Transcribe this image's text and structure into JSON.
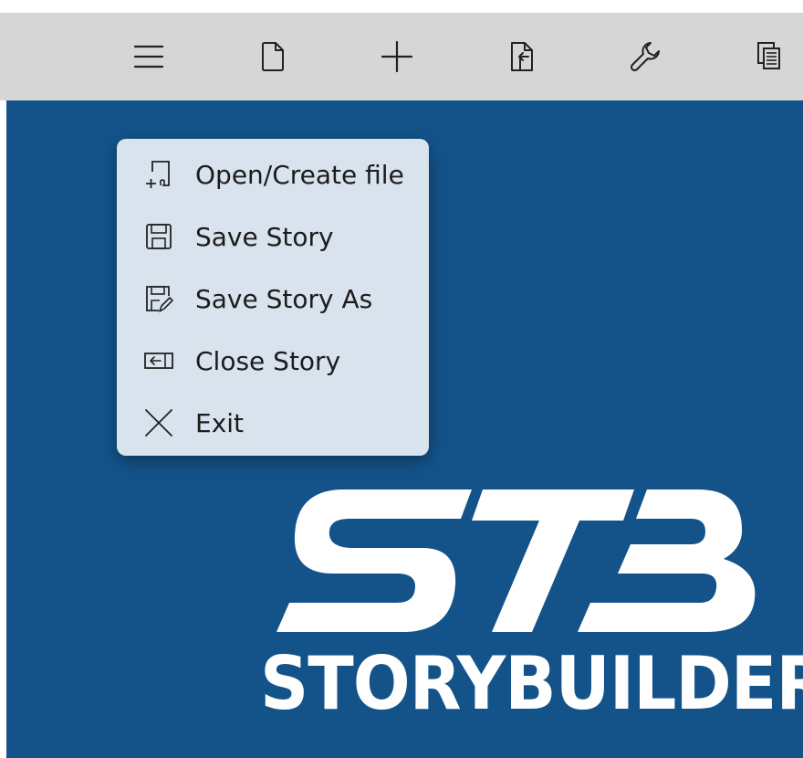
{
  "toolbar": {
    "buttons": [
      {
        "name": "menu",
        "icon": "hamburger-icon"
      },
      {
        "name": "new-file",
        "icon": "document-icon"
      },
      {
        "name": "add",
        "icon": "plus-icon"
      },
      {
        "name": "import",
        "icon": "import-icon"
      },
      {
        "name": "tools",
        "icon": "wrench-icon"
      },
      {
        "name": "copy",
        "icon": "copy-icon"
      }
    ]
  },
  "menu": {
    "items": [
      {
        "label": "Open/Create file",
        "icon": "open-create-file-icon"
      },
      {
        "label": "Save Story",
        "icon": "save-icon"
      },
      {
        "label": "Save Story As",
        "icon": "save-as-icon"
      },
      {
        "label": "Close Story",
        "icon": "close-story-icon"
      },
      {
        "label": "Exit",
        "icon": "close-icon"
      }
    ]
  },
  "logo": {
    "mark": "STB",
    "wordmark": "STORYBUILDER"
  },
  "colors": {
    "toolbar_bg": "#d6d6d6",
    "canvas_bg": "#13538a",
    "menu_bg": "#d9e3ed",
    "logo": "#ffffff"
  }
}
